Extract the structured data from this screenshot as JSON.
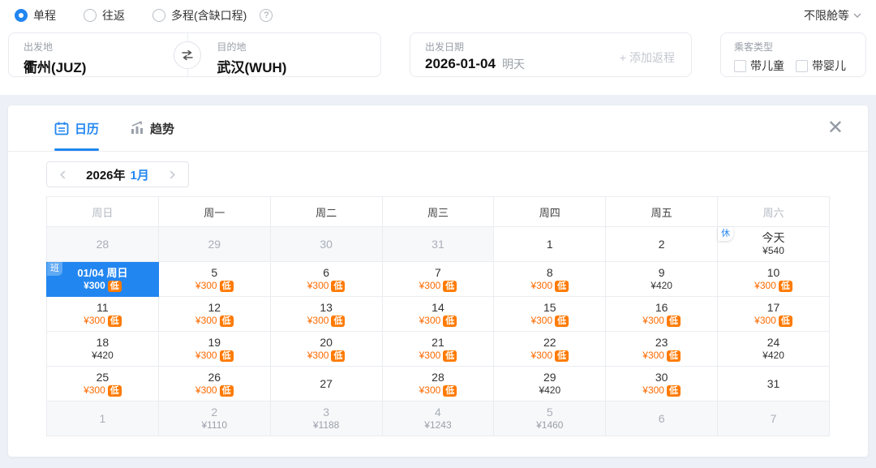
{
  "colors": {
    "accent": "#2286f0",
    "accent_light": "#5fa9f4",
    "price_low": "#ff6a00",
    "low_badge_bg": "#ff7a00"
  },
  "trip_types": [
    {
      "label": "单程",
      "selected": true
    },
    {
      "label": "往返",
      "selected": false
    },
    {
      "label": "多程(含缺口程)",
      "selected": false
    }
  ],
  "help_icon": "?",
  "cabin_filter": {
    "label": "不限舱等"
  },
  "search_form": {
    "from": {
      "label": "出发地",
      "value": "衢州(JUZ)"
    },
    "to": {
      "label": "目的地",
      "value": "武汉(WUH)"
    },
    "date": {
      "label": "出发日期",
      "value": "2026-01-04",
      "hint": "明天"
    },
    "add_return": "+ 添加返程",
    "passenger": {
      "label": "乘客类型",
      "options": [
        "带儿童",
        "带婴儿"
      ]
    }
  },
  "panel": {
    "tabs": [
      {
        "label": "日历",
        "active": true
      },
      {
        "label": "趋势",
        "active": false
      }
    ],
    "close_icon": "✕",
    "month_nav": {
      "year": "2026年",
      "month": "1月"
    },
    "weekdays": [
      {
        "label": "周日",
        "muted": true
      },
      {
        "label": "周一",
        "muted": false
      },
      {
        "label": "周二",
        "muted": false
      },
      {
        "label": "周三",
        "muted": false
      },
      {
        "label": "周四",
        "muted": false
      },
      {
        "label": "周五",
        "muted": false
      },
      {
        "label": "周六",
        "muted": true
      }
    ],
    "low_badge_label": "低",
    "weeks": [
      [
        {
          "day": "28",
          "muted": true
        },
        {
          "day": "29",
          "muted": true
        },
        {
          "day": "30",
          "muted": true
        },
        {
          "day": "31",
          "muted": true
        },
        {
          "day": "1"
        },
        {
          "day": "2"
        },
        {
          "day": "今天",
          "price": "¥540",
          "corner": "休",
          "corner_type": "rest"
        }
      ],
      [
        {
          "day": "01/04 周日",
          "price": "¥300",
          "low": true,
          "selected": true,
          "corner": "班",
          "corner_type": "flight"
        },
        {
          "day": "5",
          "price": "¥300",
          "low": true
        },
        {
          "day": "6",
          "price": "¥300",
          "low": true
        },
        {
          "day": "7",
          "price": "¥300",
          "low": true
        },
        {
          "day": "8",
          "price": "¥300",
          "low": true
        },
        {
          "day": "9",
          "price": "¥420"
        },
        {
          "day": "10",
          "price": "¥300",
          "low": true
        }
      ],
      [
        {
          "day": "11",
          "price": "¥300",
          "low": true
        },
        {
          "day": "12",
          "price": "¥300",
          "low": true
        },
        {
          "day": "13",
          "price": "¥300",
          "low": true
        },
        {
          "day": "14",
          "price": "¥300",
          "low": true
        },
        {
          "day": "15",
          "price": "¥300",
          "low": true
        },
        {
          "day": "16",
          "price": "¥300",
          "low": true
        },
        {
          "day": "17",
          "price": "¥300",
          "low": true
        }
      ],
      [
        {
          "day": "18",
          "price": "¥420"
        },
        {
          "day": "19",
          "price": "¥300",
          "low": true
        },
        {
          "day": "20",
          "price": "¥300",
          "low": true
        },
        {
          "day": "21",
          "price": "¥300",
          "low": true
        },
        {
          "day": "22",
          "price": "¥300",
          "low": true
        },
        {
          "day": "23",
          "price": "¥300",
          "low": true
        },
        {
          "day": "24",
          "price": "¥420"
        }
      ],
      [
        {
          "day": "25",
          "price": "¥300",
          "low": true
        },
        {
          "day": "26",
          "price": "¥300",
          "low": true
        },
        {
          "day": "27"
        },
        {
          "day": "28",
          "price": "¥300",
          "low": true
        },
        {
          "day": "29",
          "price": "¥420"
        },
        {
          "day": "30",
          "price": "¥300",
          "low": true
        },
        {
          "day": "31"
        }
      ],
      [
        {
          "day": "1",
          "muted": true
        },
        {
          "day": "2",
          "price": "¥1110",
          "muted": true
        },
        {
          "day": "3",
          "price": "¥1188",
          "muted": true
        },
        {
          "day": "4",
          "price": "¥1243",
          "muted": true
        },
        {
          "day": "5",
          "price": "¥1460",
          "muted": true
        },
        {
          "day": "6",
          "muted": true
        },
        {
          "day": "7",
          "muted": true
        }
      ]
    ]
  }
}
